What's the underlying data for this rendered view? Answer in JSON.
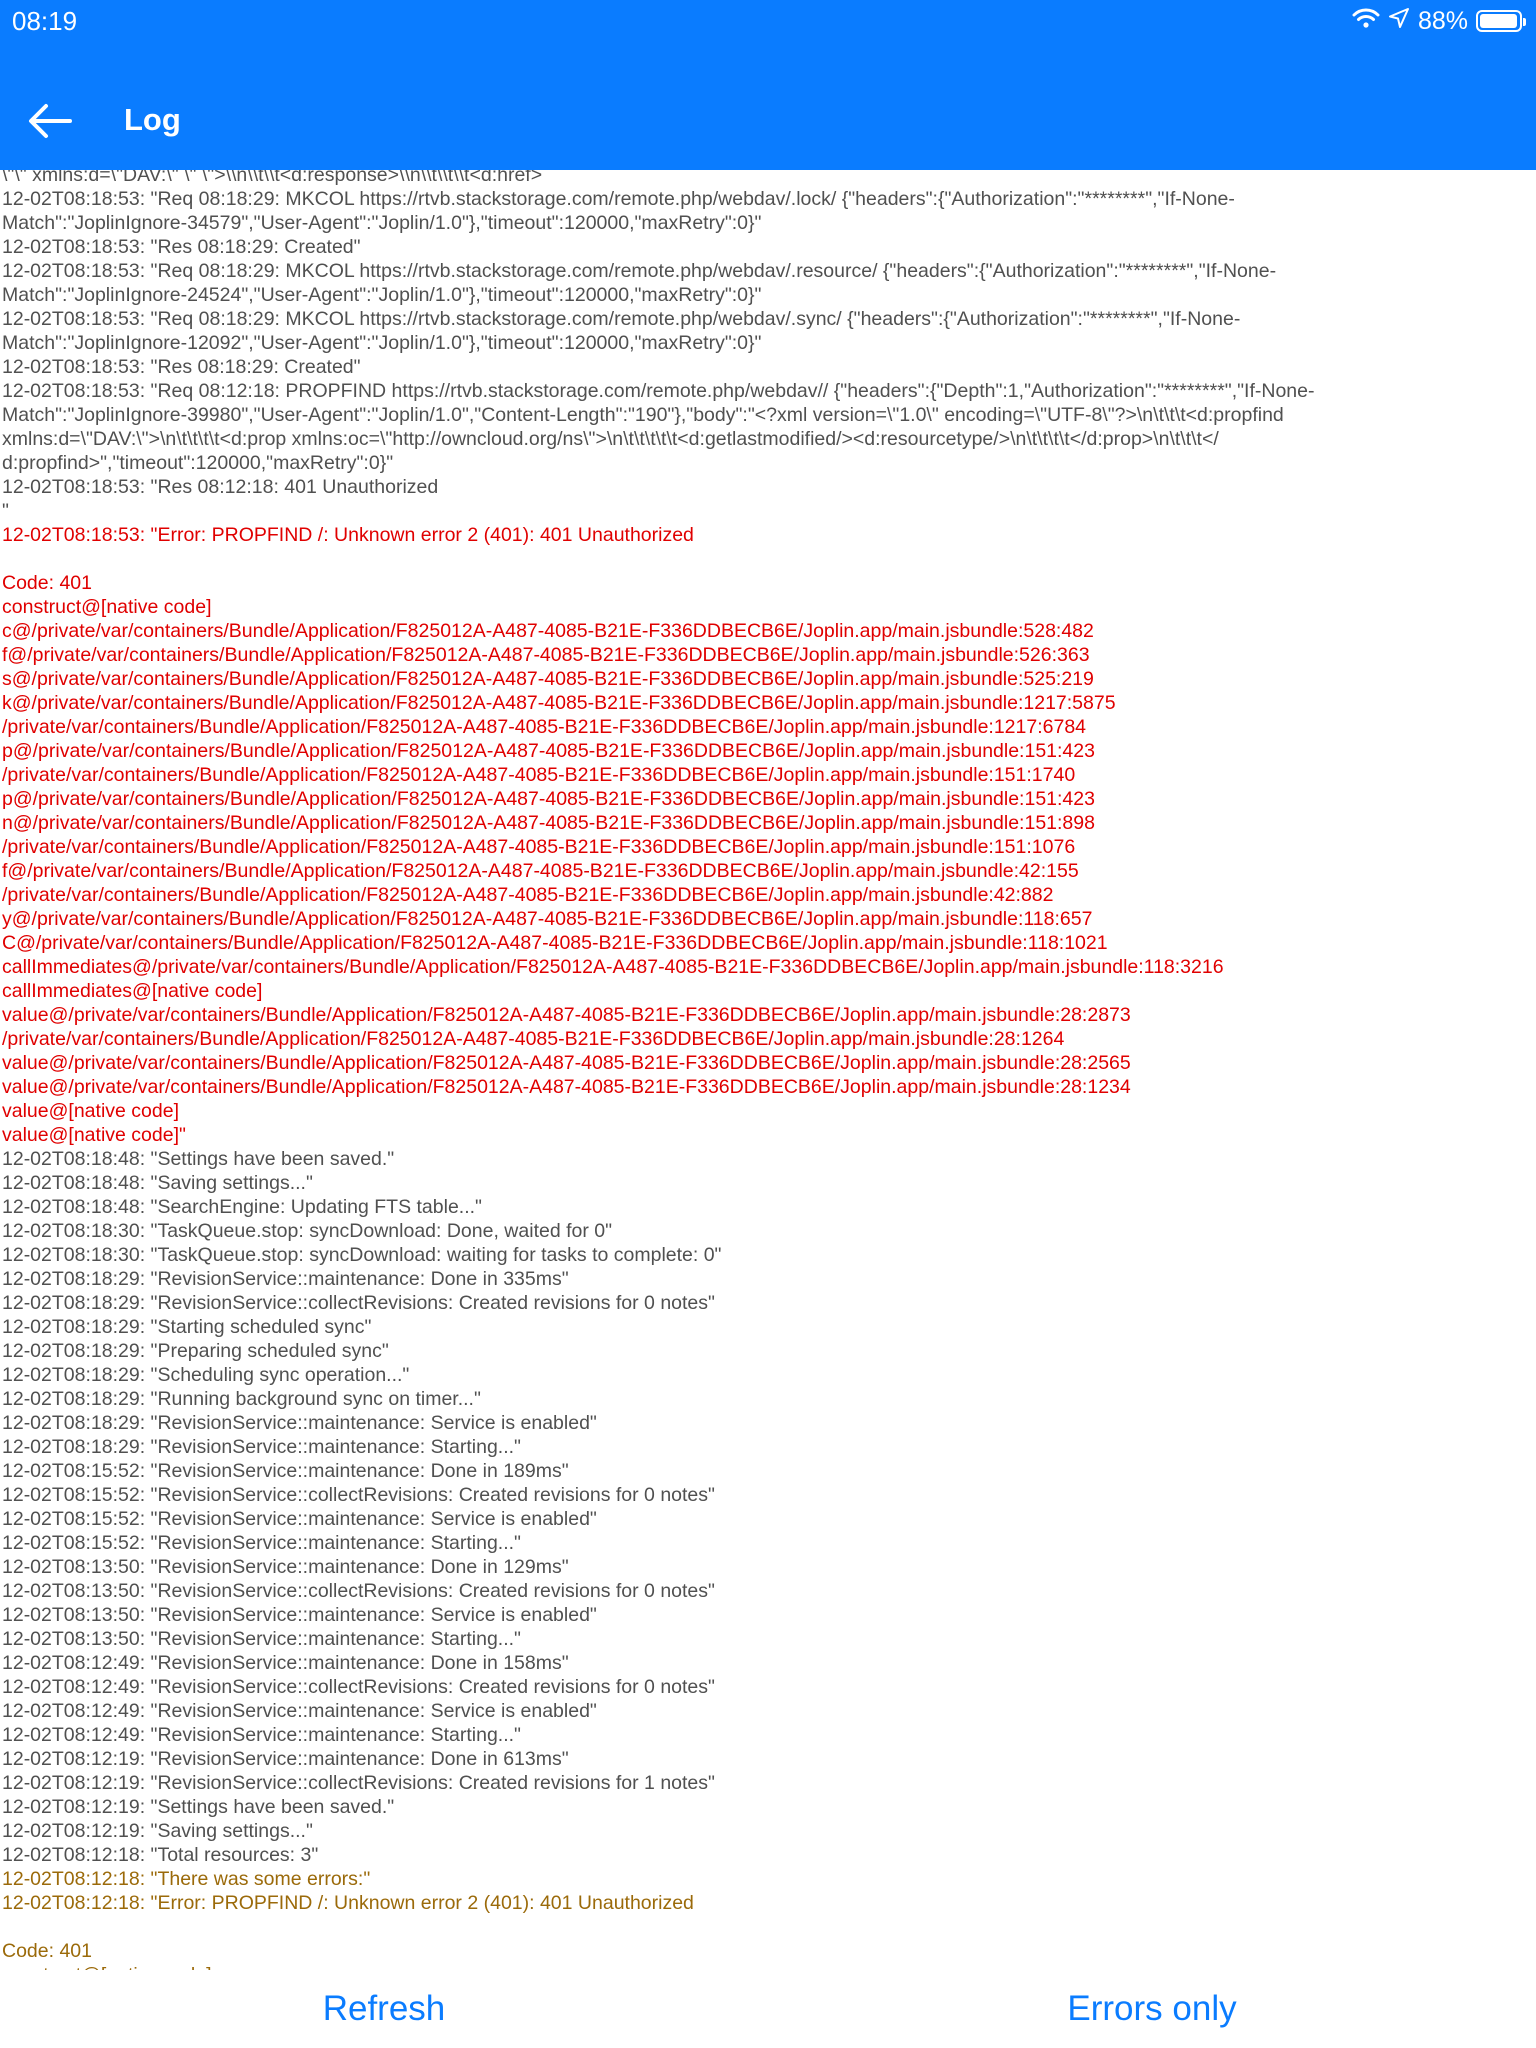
{
  "status_bar": {
    "time": "08:19",
    "battery_percent": "88%"
  },
  "header": {
    "title": "Log"
  },
  "log": {
    "lines": [
      {
        "text": "\\\"\\\" xmlns:d=\\\"DAV:\\\" \\\" \\\">\\\\n\\\\t\\\\t<d:response>\\\\n\\\\t\\\\t\\\\t<d:href>",
        "kind": "normal"
      },
      {
        "text": "12-02T08:18:53: \"Req 08:18:29: MKCOL https://rtvb.stackstorage.com/remote.php/webdav/.lock/ {\"headers\":{\"Authorization\":\"********\",\"If-None-",
        "kind": "normal"
      },
      {
        "text": "Match\":\"JoplinIgnore-34579\",\"User-Agent\":\"Joplin/1.0\"},\"timeout\":120000,\"maxRetry\":0}\"",
        "kind": "normal"
      },
      {
        "text": "12-02T08:18:53: \"Res 08:18:29: Created\"",
        "kind": "normal"
      },
      {
        "text": "12-02T08:18:53: \"Req 08:18:29: MKCOL https://rtvb.stackstorage.com/remote.php/webdav/.resource/ {\"headers\":{\"Authorization\":\"********\",\"If-None-",
        "kind": "normal"
      },
      {
        "text": "Match\":\"JoplinIgnore-24524\",\"User-Agent\":\"Joplin/1.0\"},\"timeout\":120000,\"maxRetry\":0}\"",
        "kind": "normal"
      },
      {
        "text": "12-02T08:18:53: \"Req 08:18:29: MKCOL https://rtvb.stackstorage.com/remote.php/webdav/.sync/ {\"headers\":{\"Authorization\":\"********\",\"If-None-",
        "kind": "normal"
      },
      {
        "text": "Match\":\"JoplinIgnore-12092\",\"User-Agent\":\"Joplin/1.0\"},\"timeout\":120000,\"maxRetry\":0}\"",
        "kind": "normal"
      },
      {
        "text": "12-02T08:18:53: \"Res 08:18:29: Created\"",
        "kind": "normal"
      },
      {
        "text": "12-02T08:18:53: \"Req 08:12:18: PROPFIND https://rtvb.stackstorage.com/remote.php/webdav// {\"headers\":{\"Depth\":1,\"Authorization\":\"********\",\"If-None-",
        "kind": "normal"
      },
      {
        "text": "Match\":\"JoplinIgnore-39980\",\"User-Agent\":\"Joplin/1.0\",\"Content-Length\":\"190\"},\"body\":\"<?xml version=\\\"1.0\\\" encoding=\\\"UTF-8\\\"?>\\n\\t\\t\\t<d:propfind",
        "kind": "normal"
      },
      {
        "text": "xmlns:d=\\\"DAV:\\\">\\n\\t\\t\\t\\t<d:prop xmlns:oc=\\\"http://owncloud.org/ns\\\">\\n\\t\\t\\t\\t\\t<d:getlastmodified/><d:resourcetype/>\\n\\t\\t\\t\\t</d:prop>\\n\\t\\t\\t</",
        "kind": "normal"
      },
      {
        "text": "d:propfind>\",\"timeout\":120000,\"maxRetry\":0}\"",
        "kind": "normal"
      },
      {
        "text": "12-02T08:18:53: \"Res 08:12:18: 401 Unauthorized",
        "kind": "normal"
      },
      {
        "text": "\"",
        "kind": "normal"
      },
      {
        "text": "12-02T08:18:53: \"Error: PROPFIND /: Unknown error 2 (401): 401 Unauthorized",
        "kind": "error"
      },
      {
        "text": "",
        "kind": "error"
      },
      {
        "text": "Code: 401",
        "kind": "error"
      },
      {
        "text": "construct@[native code]",
        "kind": "error"
      },
      {
        "text": "c@/private/var/containers/Bundle/Application/F825012A-A487-4085-B21E-F336DDBECB6E/Joplin.app/main.jsbundle:528:482",
        "kind": "error"
      },
      {
        "text": "f@/private/var/containers/Bundle/Application/F825012A-A487-4085-B21E-F336DDBECB6E/Joplin.app/main.jsbundle:526:363",
        "kind": "error"
      },
      {
        "text": "s@/private/var/containers/Bundle/Application/F825012A-A487-4085-B21E-F336DDBECB6E/Joplin.app/main.jsbundle:525:219",
        "kind": "error"
      },
      {
        "text": "k@/private/var/containers/Bundle/Application/F825012A-A487-4085-B21E-F336DDBECB6E/Joplin.app/main.jsbundle:1217:5875",
        "kind": "error"
      },
      {
        "text": "/private/var/containers/Bundle/Application/F825012A-A487-4085-B21E-F336DDBECB6E/Joplin.app/main.jsbundle:1217:6784",
        "kind": "error"
      },
      {
        "text": "p@/private/var/containers/Bundle/Application/F825012A-A487-4085-B21E-F336DDBECB6E/Joplin.app/main.jsbundle:151:423",
        "kind": "error"
      },
      {
        "text": "/private/var/containers/Bundle/Application/F825012A-A487-4085-B21E-F336DDBECB6E/Joplin.app/main.jsbundle:151:1740",
        "kind": "error"
      },
      {
        "text": "p@/private/var/containers/Bundle/Application/F825012A-A487-4085-B21E-F336DDBECB6E/Joplin.app/main.jsbundle:151:423",
        "kind": "error"
      },
      {
        "text": "n@/private/var/containers/Bundle/Application/F825012A-A487-4085-B21E-F336DDBECB6E/Joplin.app/main.jsbundle:151:898",
        "kind": "error"
      },
      {
        "text": "/private/var/containers/Bundle/Application/F825012A-A487-4085-B21E-F336DDBECB6E/Joplin.app/main.jsbundle:151:1076",
        "kind": "error"
      },
      {
        "text": "f@/private/var/containers/Bundle/Application/F825012A-A487-4085-B21E-F336DDBECB6E/Joplin.app/main.jsbundle:42:155",
        "kind": "error"
      },
      {
        "text": "/private/var/containers/Bundle/Application/F825012A-A487-4085-B21E-F336DDBECB6E/Joplin.app/main.jsbundle:42:882",
        "kind": "error"
      },
      {
        "text": "y@/private/var/containers/Bundle/Application/F825012A-A487-4085-B21E-F336DDBECB6E/Joplin.app/main.jsbundle:118:657",
        "kind": "error"
      },
      {
        "text": "C@/private/var/containers/Bundle/Application/F825012A-A487-4085-B21E-F336DDBECB6E/Joplin.app/main.jsbundle:118:1021",
        "kind": "error"
      },
      {
        "text": "callImmediates@/private/var/containers/Bundle/Application/F825012A-A487-4085-B21E-F336DDBECB6E/Joplin.app/main.jsbundle:118:3216",
        "kind": "error"
      },
      {
        "text": "callImmediates@[native code]",
        "kind": "error"
      },
      {
        "text": "value@/private/var/containers/Bundle/Application/F825012A-A487-4085-B21E-F336DDBECB6E/Joplin.app/main.jsbundle:28:2873",
        "kind": "error"
      },
      {
        "text": "/private/var/containers/Bundle/Application/F825012A-A487-4085-B21E-F336DDBECB6E/Joplin.app/main.jsbundle:28:1264",
        "kind": "error"
      },
      {
        "text": "value@/private/var/containers/Bundle/Application/F825012A-A487-4085-B21E-F336DDBECB6E/Joplin.app/main.jsbundle:28:2565",
        "kind": "error"
      },
      {
        "text": "value@/private/var/containers/Bundle/Application/F825012A-A487-4085-B21E-F336DDBECB6E/Joplin.app/main.jsbundle:28:1234",
        "kind": "error"
      },
      {
        "text": "value@[native code]",
        "kind": "error"
      },
      {
        "text": "value@[native code]\"",
        "kind": "error"
      },
      {
        "text": "12-02T08:18:48: \"Settings have been saved.\"",
        "kind": "normal"
      },
      {
        "text": "12-02T08:18:48: \"Saving settings...\"",
        "kind": "normal"
      },
      {
        "text": "12-02T08:18:48: \"SearchEngine: Updating FTS table...\"",
        "kind": "normal"
      },
      {
        "text": "12-02T08:18:30: \"TaskQueue.stop: syncDownload: Done, waited for 0\"",
        "kind": "normal"
      },
      {
        "text": "12-02T08:18:30: \"TaskQueue.stop: syncDownload: waiting for tasks to complete: 0\"",
        "kind": "normal"
      },
      {
        "text": "12-02T08:18:29: \"RevisionService::maintenance: Done in 335ms\"",
        "kind": "normal"
      },
      {
        "text": "12-02T08:18:29: \"RevisionService::collectRevisions: Created revisions for 0 notes\"",
        "kind": "normal"
      },
      {
        "text": "12-02T08:18:29: \"Starting scheduled sync\"",
        "kind": "normal"
      },
      {
        "text": "12-02T08:18:29: \"Preparing scheduled sync\"",
        "kind": "normal"
      },
      {
        "text": "12-02T08:18:29: \"Scheduling sync operation...\"",
        "kind": "normal"
      },
      {
        "text": "12-02T08:18:29: \"Running background sync on timer...\"",
        "kind": "normal"
      },
      {
        "text": "12-02T08:18:29: \"RevisionService::maintenance: Service is enabled\"",
        "kind": "normal"
      },
      {
        "text": "12-02T08:18:29: \"RevisionService::maintenance: Starting...\"",
        "kind": "normal"
      },
      {
        "text": "12-02T08:15:52: \"RevisionService::maintenance: Done in 189ms\"",
        "kind": "normal"
      },
      {
        "text": "12-02T08:15:52: \"RevisionService::collectRevisions: Created revisions for 0 notes\"",
        "kind": "normal"
      },
      {
        "text": "12-02T08:15:52: \"RevisionService::maintenance: Service is enabled\"",
        "kind": "normal"
      },
      {
        "text": "12-02T08:15:52: \"RevisionService::maintenance: Starting...\"",
        "kind": "normal"
      },
      {
        "text": "12-02T08:13:50: \"RevisionService::maintenance: Done in 129ms\"",
        "kind": "normal"
      },
      {
        "text": "12-02T08:13:50: \"RevisionService::collectRevisions: Created revisions for 0 notes\"",
        "kind": "normal"
      },
      {
        "text": "12-02T08:13:50: \"RevisionService::maintenance: Service is enabled\"",
        "kind": "normal"
      },
      {
        "text": "12-02T08:13:50: \"RevisionService::maintenance: Starting...\"",
        "kind": "normal"
      },
      {
        "text": "12-02T08:12:49: \"RevisionService::maintenance: Done in 158ms\"",
        "kind": "normal"
      },
      {
        "text": "12-02T08:12:49: \"RevisionService::collectRevisions: Created revisions for 0 notes\"",
        "kind": "normal"
      },
      {
        "text": "12-02T08:12:49: \"RevisionService::maintenance: Service is enabled\"",
        "kind": "normal"
      },
      {
        "text": "12-02T08:12:49: \"RevisionService::maintenance: Starting...\"",
        "kind": "normal"
      },
      {
        "text": "12-02T08:12:19: \"RevisionService::maintenance: Done in 613ms\"",
        "kind": "normal"
      },
      {
        "text": "12-02T08:12:19: \"RevisionService::collectRevisions: Created revisions for 1 notes\"",
        "kind": "normal"
      },
      {
        "text": "12-02T08:12:19: \"Settings have been saved.\"",
        "kind": "normal"
      },
      {
        "text": "12-02T08:12:19: \"Saving settings...\"",
        "kind": "normal"
      },
      {
        "text": "12-02T08:12:18: \"Total resources: 3\"",
        "kind": "normal"
      },
      {
        "text": "12-02T08:12:18: \"There was some errors:\"",
        "kind": "warn"
      },
      {
        "text": "12-02T08:12:18: \"Error: PROPFIND /: Unknown error 2 (401): 401 Unauthorized",
        "kind": "warn"
      },
      {
        "text": "",
        "kind": "warn"
      },
      {
        "text": "Code: 401",
        "kind": "warn"
      },
      {
        "text": "construct@[native code]",
        "kind": "warn"
      }
    ]
  },
  "footer": {
    "refresh_label": "Refresh",
    "errors_only_label": "Errors only"
  },
  "colors": {
    "header_bg": "#0a7cff",
    "accent": "#0a7cff",
    "log_normal": "#505050",
    "log_error": "#e00000",
    "log_warn": "#9b6a0a"
  }
}
